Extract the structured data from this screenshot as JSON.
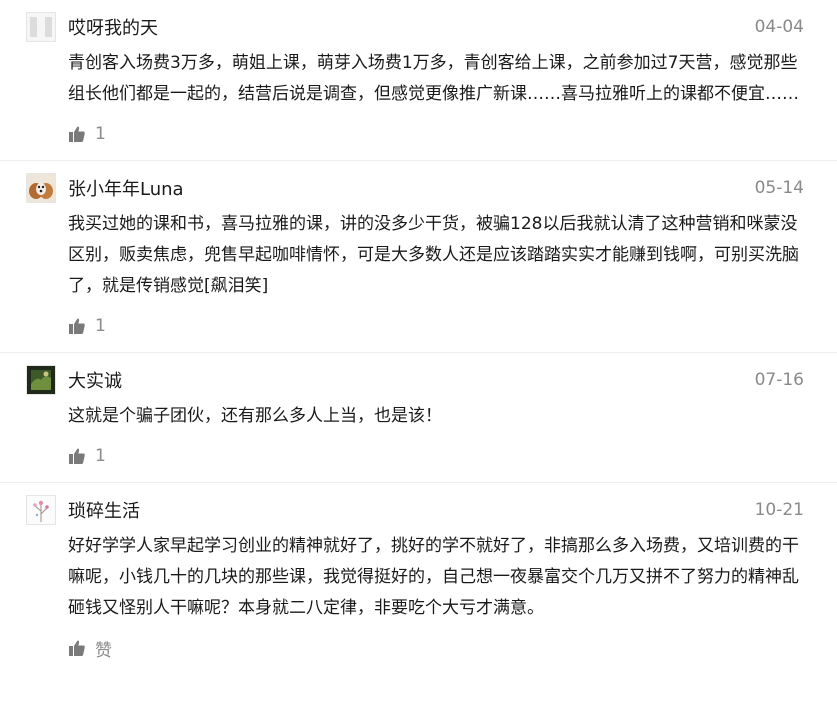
{
  "comments": [
    {
      "author": "哎呀我的天",
      "date": "04-04",
      "text": "青创客入场费3万多，萌姐上课，萌芽入场费1万多，青创客给上课，之前参加过7天营，感觉那些组长他们都是一起的，结营后说是调查，但感觉更像推广新课……喜马拉雅听上的课都不便宜……",
      "likes": "1",
      "avatar_icon": "blank-avatar-icon"
    },
    {
      "author": "张小年年Luna",
      "date": "05-14",
      "text": "我买过她的课和书，喜马拉雅的课，讲的没多少干货，被骗128以后我就认清了这种营销和咪蒙没区别，贩卖焦虑，兜售早起咖啡情怀，可是大多数人还是应该踏踏实实才能赚到钱啊，可别买洗脑了，就是传销感觉[飙泪笑]",
      "likes": "1",
      "avatar_icon": "dog-photo-avatar-icon"
    },
    {
      "author": "大实诚",
      "date": "07-16",
      "text": "这就是个骗子团伙，还有那么多人上当，也是该！",
      "likes": "1",
      "avatar_icon": "landscape-photo-avatar-icon"
    },
    {
      "author": "琐碎生活",
      "date": "10-21",
      "text": "好好学学人家早起学习创业的精神就好了，挑好的学不就好了，非搞那么多入场费，又培训费的干嘛呢，小钱几十的几块的那些课，我觉得挺好的，自己想一夜暴富交个几万又拼不了努力的精神乱砸钱又怪别人干嘛呢？本身就二八定律，非要吃个大亏才满意。",
      "likes": "赞",
      "avatar_icon": "flower-sketch-avatar-icon"
    }
  ],
  "colors": {
    "text": "#1a1a1a",
    "meta": "#8a8a8a",
    "divider": "#eeeeee"
  }
}
